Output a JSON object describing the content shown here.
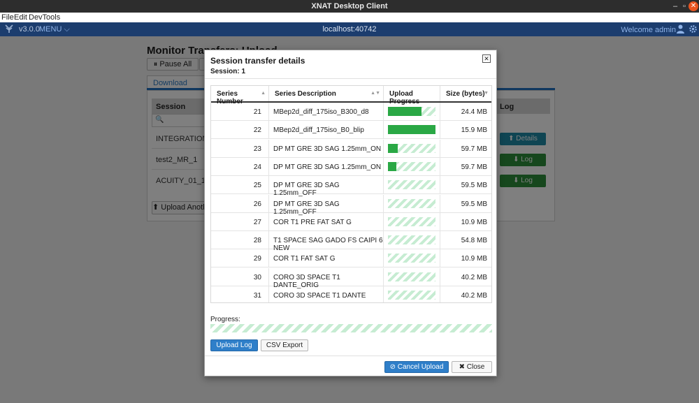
{
  "window": {
    "title": "XNAT Desktop Client",
    "minimize": "–",
    "maximize": "▫",
    "close": "✕"
  },
  "menubar": {
    "items": [
      "File",
      "Edit",
      "DevTools"
    ]
  },
  "app_header": {
    "version": "v3.0.0",
    "menu_label": "MENU",
    "host": "localhost:40742",
    "welcome": "Welcome admin"
  },
  "background_page": {
    "title": "Monitor Transfers: Upload",
    "pause_all": "Pause All",
    "tab_download": "Download Progress",
    "col_session": "Session",
    "col_log": "Log",
    "rows": [
      "INTEGRATION_S01",
      "test2_MR_1",
      "ACUITY_01_16_V6"
    ],
    "details_btn": "Details",
    "log_btn": "Log",
    "upload_another": "Upload Another"
  },
  "modal": {
    "title": "Session transfer details",
    "session_label": "Session: 1",
    "columns": {
      "series_number": "Series Number",
      "series_description": "Series Description",
      "upload_progress": "Upload Progress",
      "size": "Size (bytes)"
    },
    "rows": [
      {
        "number": "21",
        "description": "MBep2d_diff_175iso_B300_d8",
        "progress": 0.7,
        "size": "24.4 MB"
      },
      {
        "number": "22",
        "description": "MBep2d_diff_175iso_B0_blip",
        "progress": 1.0,
        "size": "15.9 MB"
      },
      {
        "number": "23",
        "description": "DP MT GRE 3D SAG 1.25mm_ON",
        "progress": 0.2,
        "size": "59.7 MB"
      },
      {
        "number": "24",
        "description": "DP MT GRE 3D SAG 1.25mm_ON",
        "progress": 0.18,
        "size": "59.7 MB"
      },
      {
        "number": "25",
        "description": "DP MT GRE 3D SAG 1.25mm_OFF",
        "progress": 0,
        "size": "59.5 MB"
      },
      {
        "number": "26",
        "description": "DP MT GRE 3D SAG 1.25mm_OFF",
        "progress": 0,
        "size": "59.5 MB"
      },
      {
        "number": "27",
        "description": "COR T1 PRE FAT SAT G",
        "progress": 0,
        "size": "10.9 MB"
      },
      {
        "number": "28",
        "description": "T1 SPACE SAG GADO FS CAIPI 6 NEW",
        "progress": 0,
        "size": "54.8 MB"
      },
      {
        "number": "29",
        "description": "COR T1 FAT SAT G",
        "progress": 0,
        "size": "10.9 MB"
      },
      {
        "number": "30",
        "description": "CORO 3D SPACE T1 DANTE_ORIG",
        "progress": 0,
        "size": "40.2 MB"
      },
      {
        "number": "31",
        "description": "CORO 3D SPACE T1 DANTE",
        "progress": 0,
        "size": "40.2 MB"
      }
    ],
    "progress_label": "Progress:",
    "overall_progress": 0,
    "upload_log_btn": "Upload Log",
    "csv_export_btn": "CSV Export",
    "cancel_upload_btn": "Cancel Upload",
    "close_btn": "Close"
  },
  "colors": {
    "progress_green": "#2aa845",
    "progress_stripe": "#c6ecd2",
    "primary_blue": "#2f7fc9",
    "header_navy": "#1c3d6e"
  }
}
